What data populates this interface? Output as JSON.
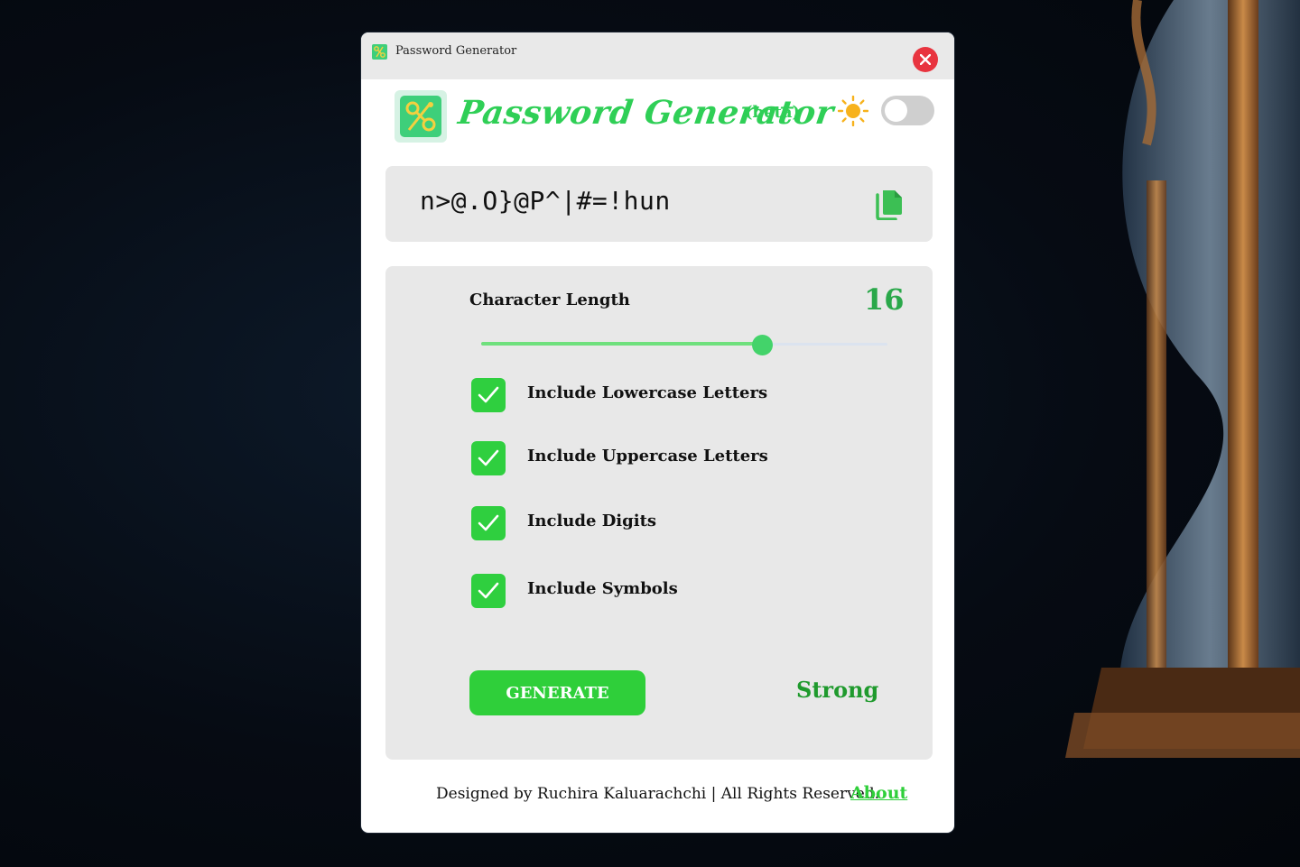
{
  "window": {
    "title": "Password Generator"
  },
  "header": {
    "app_title": "Password Generator",
    "beta_label": "(beta)",
    "theme_icon": "sun-icon",
    "dark_mode_enabled": false
  },
  "password": {
    "value": "n>@.O}@P^|#=!hun",
    "copy_icon": "copy-icon"
  },
  "length": {
    "label": "Character Length",
    "value": "16",
    "slider_fraction": 0.69
  },
  "options": [
    {
      "label": "Include Lowercase Letters",
      "checked": true
    },
    {
      "label": "Include Uppercase Letters",
      "checked": true
    },
    {
      "label": "Include Digits",
      "checked": true
    },
    {
      "label": "Include Symbols",
      "checked": true
    }
  ],
  "actions": {
    "generate_label": "GENERATE",
    "strength_label": "Strong"
  },
  "footer": {
    "credit": "Designed by Ruchira Kaluarachchi | All Rights Reserved.",
    "about_link": "About"
  },
  "colors": {
    "accent_green": "#2fcf3a",
    "strength_green": "#1f9a2d",
    "close_red": "#e8343f"
  }
}
